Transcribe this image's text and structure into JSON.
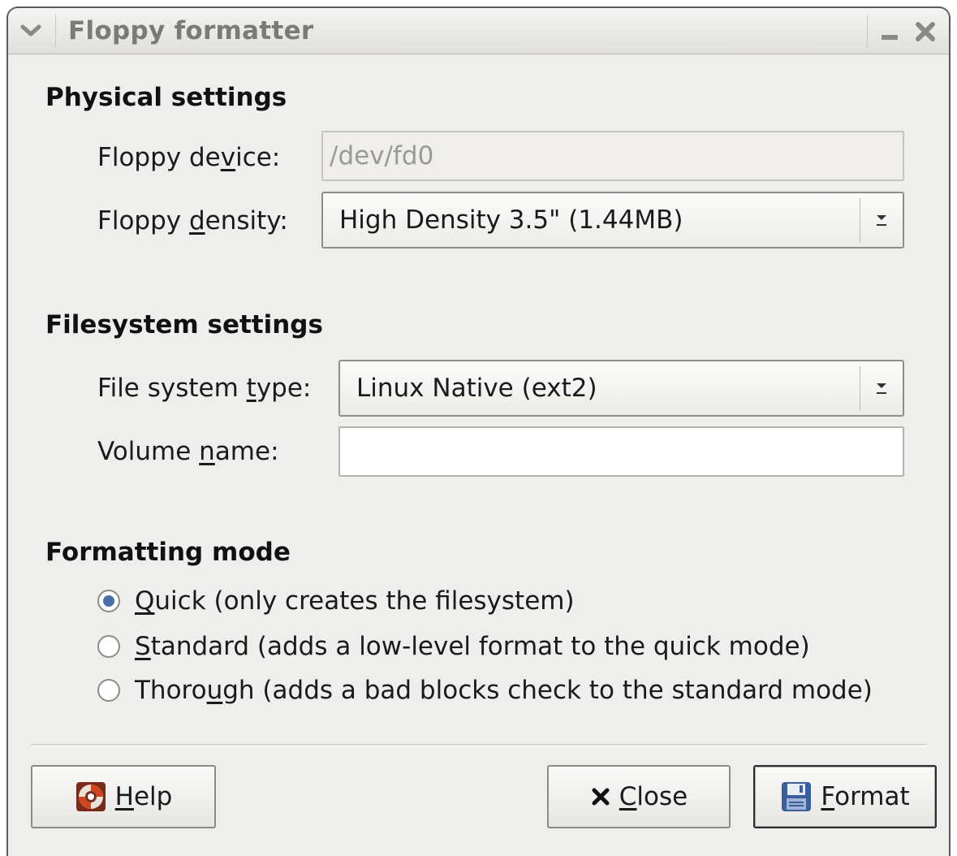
{
  "window": {
    "title": "Floppy formatter"
  },
  "physical": {
    "section_title": "Physical settings",
    "device_label_pre": "Floppy de",
    "device_label_u": "v",
    "device_label_post": "ice:",
    "device_value": "/dev/fd0",
    "density_label_pre": "Floppy ",
    "density_label_u": "d",
    "density_label_post": "ensity:",
    "density_value": "High Density 3.5\" (1.44MB)"
  },
  "filesystem": {
    "section_title": "Filesystem settings",
    "type_label_pre": "File system ",
    "type_label_u": "t",
    "type_label_post": "ype:",
    "type_value": "Linux Native (ext2)",
    "volume_label_pre": "Volume ",
    "volume_label_u": "n",
    "volume_label_post": "ame:",
    "volume_value": ""
  },
  "mode": {
    "section_title": "Formatting mode",
    "options": [
      {
        "u": "Q",
        "rest": "uick (only creates the filesystem)",
        "selected": true
      },
      {
        "u": "S",
        "rest": "tandard (adds a low-level format to the quick mode)",
        "selected": false
      },
      {
        "pre": "Thoro",
        "u": "u",
        "rest": "gh (adds a bad blocks check to the standard mode)",
        "selected": false
      }
    ]
  },
  "buttons": {
    "help_u": "H",
    "help_rest": "elp",
    "close_u": "C",
    "close_rest": "lose",
    "format_u": "F",
    "format_rest": "ormat"
  },
  "colors": {
    "window_bg": "#eeeeec",
    "radio_selected": "#4a6fa8"
  },
  "icons": [
    "window-menu-icon",
    "minimize-icon",
    "close-window-icon",
    "chevron-down-icon",
    "help-lifebuoy-icon",
    "close-x-icon",
    "floppy-disk-icon"
  ]
}
